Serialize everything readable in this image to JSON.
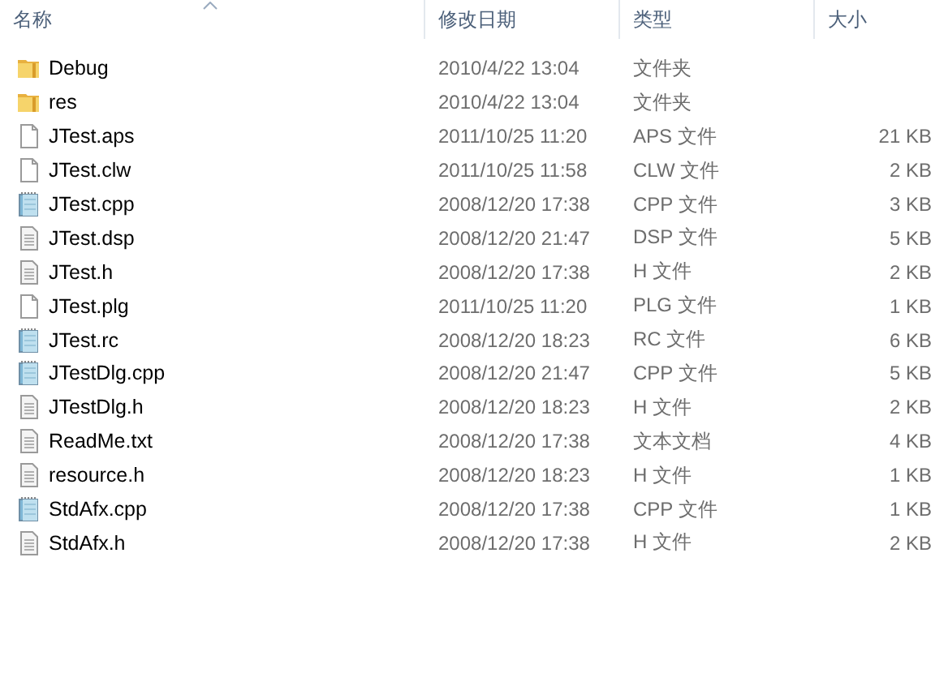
{
  "columns": [
    {
      "label": "名称",
      "sorted": true
    },
    {
      "label": "修改日期",
      "sorted": false
    },
    {
      "label": "类型",
      "sorted": false
    },
    {
      "label": "大小",
      "sorted": false
    }
  ],
  "files": [
    {
      "name": "Debug",
      "kind": "folder",
      "modified": "2010/4/22 13:04",
      "type": "文件夹"
    },
    {
      "name": "res",
      "kind": "folder",
      "modified": "2010/4/22 13:04",
      "type": "文件夹"
    },
    {
      "name": "JTest.aps",
      "kind": "blank",
      "modified": "2011/10/25 11:20",
      "type": "APS 文件",
      "size": "21 KB"
    },
    {
      "name": "JTest.clw",
      "kind": "blank",
      "modified": "2011/10/25 11:58",
      "type": "CLW 文件",
      "size": "2 KB"
    },
    {
      "name": "JTest.cpp",
      "kind": "source",
      "modified": "2008/12/20 17:38",
      "type": "CPP 文件",
      "size": "3 KB"
    },
    {
      "name": "JTest.dsp",
      "kind": "text",
      "modified": "2008/12/20 21:47",
      "type": "DSP 文件",
      "size": "5 KB"
    },
    {
      "name": "JTest.h",
      "kind": "text",
      "modified": "2008/12/20 17:38",
      "type": "H 文件",
      "size": "2 KB"
    },
    {
      "name": "JTest.plg",
      "kind": "blank",
      "modified": "2011/10/25 11:20",
      "type": "PLG 文件",
      "size": "1 KB"
    },
    {
      "name": "JTest.rc",
      "kind": "source",
      "modified": "2008/12/20 18:23",
      "type": "RC 文件",
      "size": "6 KB"
    },
    {
      "name": "JTestDlg.cpp",
      "kind": "source",
      "modified": "2008/12/20 21:47",
      "type": "CPP 文件",
      "size": "5 KB"
    },
    {
      "name": "JTestDlg.h",
      "kind": "text",
      "modified": "2008/12/20 18:23",
      "type": "H 文件",
      "size": "2 KB"
    },
    {
      "name": "ReadMe.txt",
      "kind": "text",
      "modified": "2008/12/20 17:38",
      "type": "文本文档",
      "size": "4 KB"
    },
    {
      "name": "resource.h",
      "kind": "text",
      "modified": "2008/12/20 18:23",
      "type": "H 文件",
      "size": "1 KB"
    },
    {
      "name": "StdAfx.cpp",
      "kind": "source",
      "modified": "2008/12/20 17:38",
      "type": "CPP 文件",
      "size": "1 KB"
    },
    {
      "name": "StdAfx.h",
      "kind": "text",
      "modified": "2008/12/20 17:38",
      "type": "H 文件",
      "size": "2 KB"
    }
  ]
}
